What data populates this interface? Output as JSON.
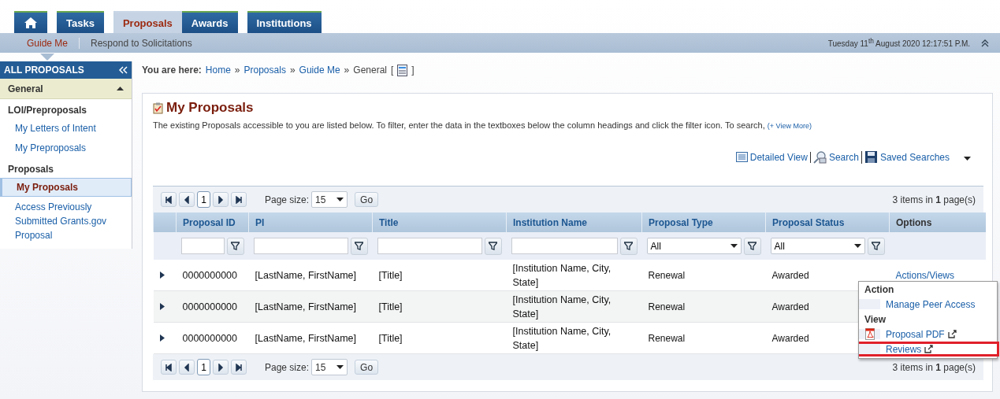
{
  "nav": {
    "tabs": [
      {
        "kind": "home",
        "selected": false
      },
      {
        "kind": "text",
        "label": "Tasks",
        "selected": false
      },
      {
        "kind": "text",
        "label": "Proposals",
        "selected": true
      },
      {
        "kind": "text",
        "label": "Awards",
        "selected": false
      },
      {
        "kind": "text",
        "label": "Institutions",
        "selected": false
      }
    ]
  },
  "subnav": {
    "items": [
      {
        "label": "Guide Me",
        "selected": true
      },
      {
        "label": "Respond to Solicitations",
        "selected": false
      }
    ],
    "datetime": "Tuesday 11$^{th}$ August 2020 12:17:51 P.M."
  },
  "sidebar": {
    "title": "ALL PROPOSALS",
    "section": {
      "label": "General",
      "expanded": true
    },
    "groups": [
      {
        "heading": "LOI/Preproposals",
        "items": [
          {
            "label": "My Letters of Intent",
            "selected": false
          },
          {
            "label": "My Preproposals",
            "selected": false
          }
        ]
      },
      {
        "heading": "Proposals",
        "items": [
          {
            "label": "My Proposals",
            "selected": true
          },
          {
            "label": "Access Previously Submitted Grants.gov Proposal",
            "selected": false
          }
        ]
      }
    ]
  },
  "breadcrumb": {
    "prefix": "You are here:",
    "links": [
      "Home",
      "Proposals",
      "Guide Me"
    ],
    "separator": "»",
    "current": "General",
    "open": "[",
    "close": "]"
  },
  "page": {
    "title": "My Proposals",
    "description": "The existing Proposals accessible to you are listed below. To filter, enter the data in the textboxes below the column headings and click the filter icon. To search,",
    "view_more": "(+ View More)"
  },
  "toolbar": {
    "links": [
      {
        "kind": "list",
        "label": "Detailed View"
      },
      {
        "kind": "search",
        "label": "Search"
      },
      {
        "kind": "save",
        "label": "Saved Searches"
      }
    ]
  },
  "top_pager": {
    "page": "1",
    "page_size_label": "Page size:",
    "page_size": "15",
    "go": "Go",
    "summary": "3 items in **1** page(s)"
  },
  "table": {
    "columns": [
      "Proposal ID",
      "PI",
      "Title",
      "Institution Name",
      "Proposal Type",
      "Proposal Status",
      "Options"
    ],
    "filters": [
      {
        "kind": "text"
      },
      {
        "kind": "text"
      },
      {
        "kind": "text"
      },
      {
        "kind": "text"
      },
      {
        "kind": "select",
        "value": "All"
      },
      {
        "kind": "select",
        "value": "All"
      }
    ],
    "rows": [
      {
        "id": "0000000000",
        "pi": "[LastName, FirstName]",
        "title": "[Title]",
        "institution": "[Institution Name, City, State]",
        "type": "Renewal",
        "status": "Awarded",
        "options": "Actions/Views"
      },
      {
        "id": "0000000000",
        "pi": "[LastName, FirstName]",
        "title": "[Title]",
        "institution": "[Institution Name, City, State]",
        "type": "Renewal",
        "status": "Awarded"
      },
      {
        "id": "0000000000",
        "pi": "[LastName, FirstName]",
        "title": "[Title]",
        "institution": "[Institution Name, City, State]",
        "type": "Renewal",
        "status": "Awarded"
      }
    ]
  },
  "bottom_pager": {
    "page": "1",
    "page_size_label": "Page size:",
    "page_size": "15",
    "go": "Go",
    "summary": "3 items in **1** page(s)"
  },
  "menu": {
    "sections": [
      {
        "heading": "Action",
        "items": [
          {
            "kind": "plain",
            "label": "Manage Peer Access",
            "external": false,
            "highlighted": false
          }
        ]
      },
      {
        "heading": "View",
        "items": [
          {
            "kind": "pdf",
            "label": "Proposal PDF",
            "external": true,
            "highlighted": false
          },
          {
            "kind": "plain",
            "label": "Reviews",
            "external": true,
            "highlighted": true
          }
        ]
      }
    ]
  }
}
